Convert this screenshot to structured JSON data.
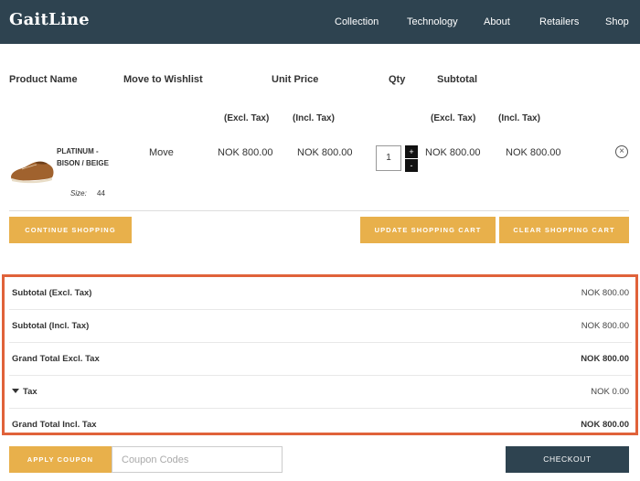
{
  "header": {
    "logo": "GaitLine",
    "nav": [
      "Collection",
      "Technology",
      "About",
      "Retailers",
      "Shop"
    ]
  },
  "table": {
    "columns": {
      "product_name": "Product Name",
      "move_to_wishlist": "Move to Wishlist",
      "unit_price": "Unit Price",
      "qty": "Qty",
      "subtotal": "Subtotal"
    },
    "sub_columns": {
      "excl_tax": "(Excl. Tax)",
      "incl_tax": "(Incl. Tax)"
    },
    "items": [
      {
        "name": "PLATINUM - BISON / BEIGE",
        "size_label": "Size:",
        "size": "44",
        "move": "Move",
        "unit_excl": "NOK 800.00",
        "unit_incl": "NOK 800.00",
        "qty": "1",
        "qty_plus": "+",
        "qty_minus": "-",
        "subtotal_excl": "NOK 800.00",
        "subtotal_incl": "NOK 800.00",
        "remove_icon": "close-circle-icon"
      }
    ]
  },
  "buttons": {
    "continue": "Continue Shopping",
    "update": "Update Shopping Cart",
    "clear": "Clear Shopping Cart",
    "apply_coupon": "Apply Coupon",
    "checkout": "Checkout"
  },
  "totals": [
    {
      "label": "Subtotal (Excl. Tax)",
      "value": "NOK 800.00"
    },
    {
      "label": "Subtotal (Incl. Tax)",
      "value": "NOK 800.00"
    },
    {
      "label": "Grand Total Excl. Tax",
      "value": "NOK 800.00"
    },
    {
      "label": "Tax",
      "value": "NOK 0.00"
    },
    {
      "label": "Grand Total Incl. Tax",
      "value": "NOK 800.00"
    }
  ],
  "coupon": {
    "placeholder": "Coupon Codes",
    "value": ""
  },
  "colors": {
    "header_bg": "#2e4350",
    "accent_gold": "#e8b04b",
    "highlight_border": "#e0623a"
  }
}
